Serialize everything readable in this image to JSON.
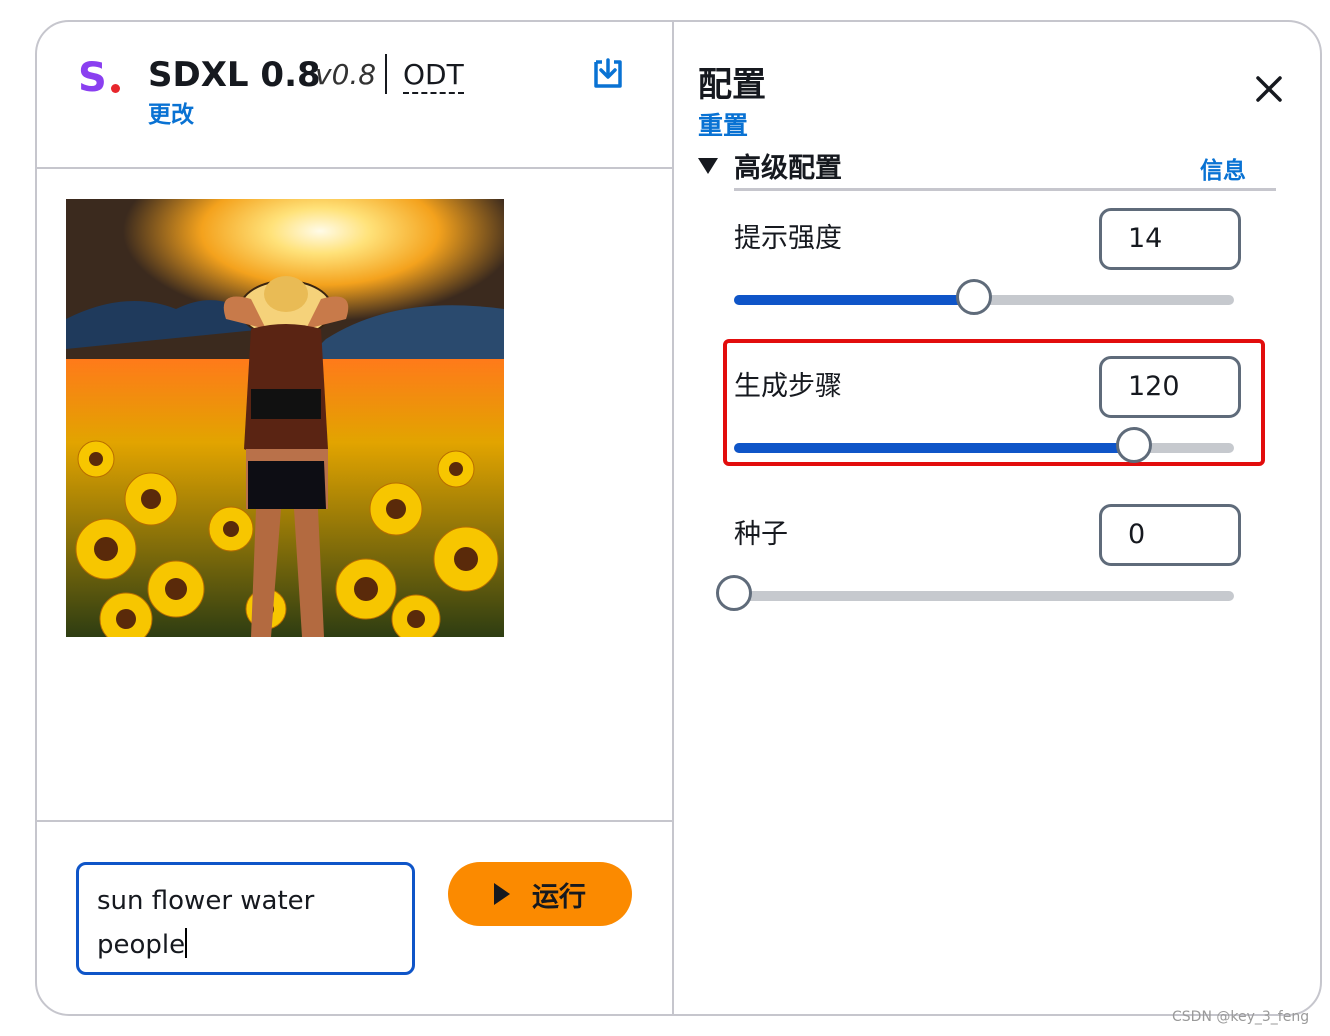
{
  "header": {
    "logo_letter": "S",
    "model_name": "SDXL 0.8",
    "version": "v0.8",
    "odt_label": "ODT",
    "change_link": "更改",
    "download_icon": "download-icon"
  },
  "prompt": {
    "value": "sun flower water\npeople"
  },
  "run_button": {
    "label": "运行",
    "icon": "play-icon",
    "color": "#fb8a00"
  },
  "config": {
    "title": "配置",
    "reset_link": "重置",
    "close_icon": "close-icon",
    "advanced": {
      "title": "高级配置",
      "info_link": "信息",
      "expanded": true
    },
    "params": [
      {
        "label": "提示强度",
        "value": "14",
        "slider_fraction": 0.48
      },
      {
        "label": "生成步骤",
        "value": "120",
        "slider_fraction": 0.8,
        "highlighted": true
      },
      {
        "label": "种子",
        "value": "0",
        "slider_fraction": 0.0
      }
    ]
  },
  "colors": {
    "accent_blue": "#0972d3",
    "slider_fill": "#0f55c8",
    "highlight_red": "#e20d0d",
    "logo_purple": "#8a3ff0"
  },
  "watermark": "CSDN @key_3_feng"
}
